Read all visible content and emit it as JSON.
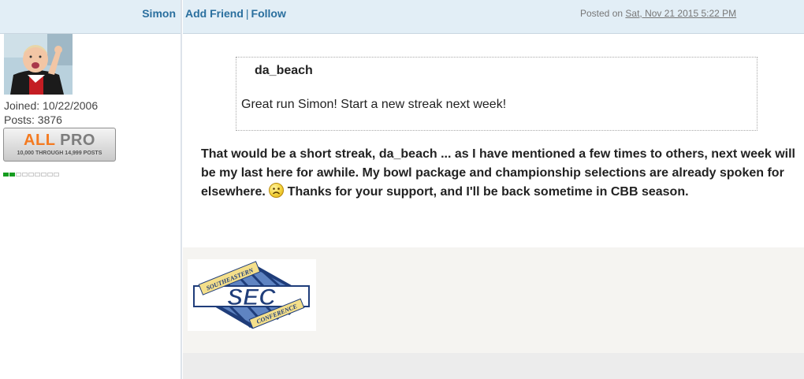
{
  "user": {
    "name": "Simon",
    "joined": "Joined: 10/22/2006",
    "posts": "Posts: 3876",
    "rank": {
      "part1": "ALL",
      "part2": "PRO",
      "subtitle": "10,000 THROUGH 14,999 POSTS"
    },
    "reputation": {
      "filled": 2,
      "total": 9
    }
  },
  "header": {
    "add_friend": "Add Friend",
    "separator": "|",
    "follow": "Follow",
    "posted_on_prefix": "Posted on",
    "posted_date": "Sat, Nov 21 2015 5:22 PM"
  },
  "quote": {
    "author": "da_beach",
    "text": "Great run Simon!  Start a new streak next week!"
  },
  "post": {
    "text_before": "That would be a short streak, da_beach ... as I have mentioned a few times to others, next week will be my last here for awhile. My bowl package and championship selections are already spoken for elsewhere.",
    "emoticon": "frown-icon",
    "text_after": "Thanks for your support, and I'll be back sometime in CBB season."
  },
  "signature": {
    "logo": "sec-conference-logo",
    "logo_text_top": "SOUTHEASTERN",
    "logo_text_main": "SEC",
    "logo_text_bottom": "CONFERENCE"
  },
  "colors": {
    "header_bg": "#e2eef6",
    "link": "#2a6f9e",
    "rep_green": "#159c1f",
    "rank_orange": "#f47a20"
  }
}
